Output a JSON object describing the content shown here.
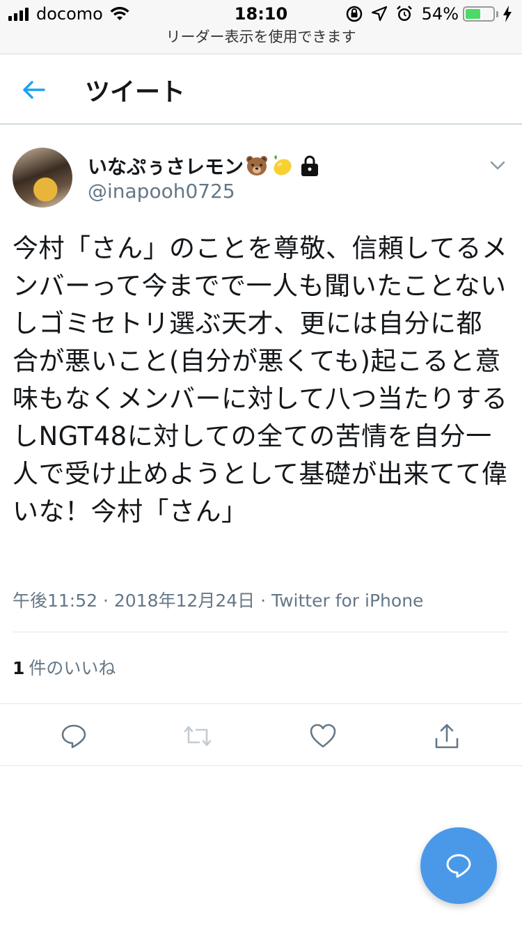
{
  "status_bar": {
    "carrier": "docomo",
    "time": "18:10",
    "battery_percent": "54%",
    "battery_level": 0.54
  },
  "reader_bar": {
    "text": "リーダー表示を使用できます"
  },
  "header": {
    "title": "ツイート"
  },
  "tweet": {
    "user_name": "いなぷぅさレモン",
    "user_handle": "@inapooh0725",
    "text": "今村「さん」のことを尊敬、信頼してるメンバーって今までで一人も聞いたことないしゴミセトリ選ぶ天才、更には自分に都合が悪いこと(自分が悪くても)起こると意味もなくメンバーに対して八つ当たりするしNGT48に対しての全ての苦情を自分一人で受け止めようとして基礎が出来てて偉いな！今村「さん」",
    "meta": "午後11:52 · 2018年12月24日 · Twitter for iPhone",
    "likes_count": "1",
    "likes_label": "件のいいね"
  },
  "icons": {
    "emoji": [
      "bear-emoji",
      "lemon-emoji",
      "lock-icon"
    ],
    "accent": "#1da1f2",
    "fab_color": "#4a99e9"
  }
}
